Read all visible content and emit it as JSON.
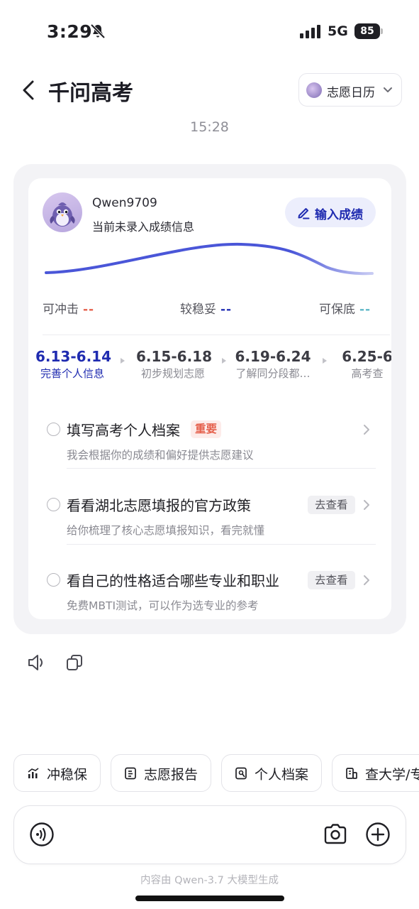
{
  "status_bar": {
    "time": "3:29",
    "network": "5G",
    "battery": "85"
  },
  "header": {
    "title": "千问高考",
    "calendar_button": "志愿日历"
  },
  "timestamp": "15:28",
  "card": {
    "username": "Qwen9709",
    "score_status": "当前未录入成绩信息",
    "input_score_label": "输入成绩",
    "levels": [
      {
        "label": "可冲击",
        "value": "--",
        "color": "#e5624e"
      },
      {
        "label": "较稳妥",
        "value": "--",
        "color": "#2431b5"
      },
      {
        "label": "可保底",
        "value": "--",
        "color": "#5fb9c8"
      }
    ],
    "timeline": [
      {
        "date": "6.13-6.14",
        "label": "完善个人信息"
      },
      {
        "date": "6.15-6.18",
        "label": "初步规划志愿"
      },
      {
        "date": "6.19-6.24",
        "label": "了解同分段都…"
      },
      {
        "date": "6.25-6",
        "label": "高考查"
      }
    ],
    "tasks": [
      {
        "title": "填写高考个人档案",
        "badge": "重要",
        "desc": "我会根据你的成绩和偏好提供志愿建议"
      },
      {
        "title": "看看湖北志愿填报的官方政策",
        "badge": "去查看",
        "desc": "给你梳理了核心志愿填报知识，看完就懂"
      },
      {
        "title": "看自己的性格适合哪些专业和职业",
        "badge": "去查看",
        "desc": "免费MBTI测试，可以作为选专业的参考"
      }
    ]
  },
  "chips": [
    {
      "label": "冲稳保",
      "icon": "chart-icon"
    },
    {
      "label": "志愿报告",
      "icon": "report-icon"
    },
    {
      "label": "个人档案",
      "icon": "profile-icon"
    },
    {
      "label": "查大学/专",
      "icon": "building-icon"
    }
  ],
  "footer_note": "内容由 Qwen-3.7 大模型生成",
  "colors": {
    "accent": "#1f2bb0",
    "accent_bg": "#eceefc",
    "important": "#e5604c"
  }
}
